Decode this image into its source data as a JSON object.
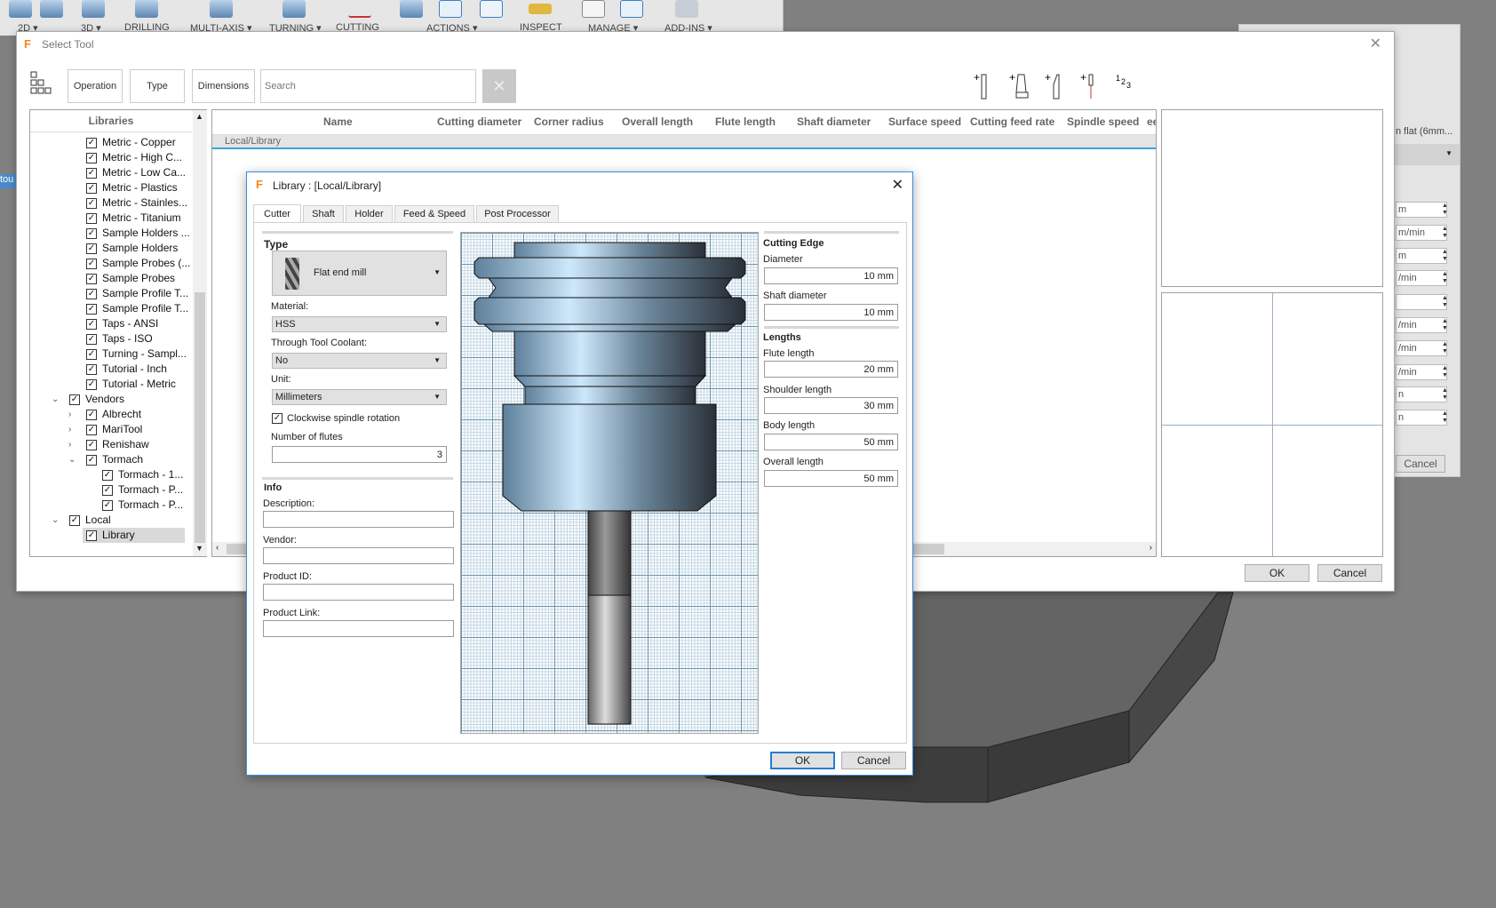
{
  "ribbon": {
    "items": [
      "2D ▾",
      "3D ▾",
      "DRILLING",
      "MULTI-AXIS ▾",
      "TURNING ▾",
      "CUTTING",
      "ACTIONS ▾",
      "INSPECT",
      "MANAGE ▾",
      "ADD-INS ▾"
    ]
  },
  "background_panel": {
    "tool_name": "n flat (6mm...",
    "fields": [
      "m",
      "m/min",
      "m",
      "/min",
      "",
      "/min",
      "/min",
      "/min",
      "n",
      "n"
    ],
    "cancel": "Cancel"
  },
  "left_tab": "tou",
  "select_tool": {
    "title": "Select Tool",
    "filters": {
      "operation": "Operation",
      "type": "Type",
      "dimensions": "Dimensions",
      "search_placeholder": "Search",
      "clear": "✕"
    },
    "libraries_header": "Libraries",
    "tree": [
      {
        "label": "Metric - Copper",
        "level": 2
      },
      {
        "label": "Metric - High C...",
        "level": 2
      },
      {
        "label": "Metric - Low Ca...",
        "level": 2
      },
      {
        "label": "Metric - Plastics",
        "level": 2
      },
      {
        "label": "Metric - Stainles...",
        "level": 2
      },
      {
        "label": "Metric - Titanium",
        "level": 2
      },
      {
        "label": "Sample Holders ...",
        "level": 2
      },
      {
        "label": "Sample Holders",
        "level": 2
      },
      {
        "label": "Sample Probes (...",
        "level": 2
      },
      {
        "label": "Sample Probes",
        "level": 2
      },
      {
        "label": "Sample Profile T...",
        "level": 2
      },
      {
        "label": "Sample Profile T...",
        "level": 2
      },
      {
        "label": "Taps - ANSI",
        "level": 2
      },
      {
        "label": "Taps - ISO",
        "level": 2
      },
      {
        "label": "Turning - Sampl...",
        "level": 2
      },
      {
        "label": "Tutorial - Inch",
        "level": 2
      },
      {
        "label": "Tutorial - Metric",
        "level": 2
      },
      {
        "label": "Vendors",
        "level": 1,
        "chevron": "down"
      },
      {
        "label": "Albrecht",
        "level": 2,
        "chevron": "right"
      },
      {
        "label": "MariTool",
        "level": 2,
        "chevron": "right"
      },
      {
        "label": "Renishaw",
        "level": 2,
        "chevron": "right"
      },
      {
        "label": "Tormach",
        "level": 2,
        "chevron": "down"
      },
      {
        "label": "Tormach - 1...",
        "level": 3
      },
      {
        "label": "Tormach - P...",
        "level": 3
      },
      {
        "label": "Tormach - P...",
        "level": 3
      },
      {
        "label": "Local",
        "level": 1,
        "chevron": "down"
      },
      {
        "label": "Library",
        "level": 2,
        "selected": true
      }
    ],
    "columns": [
      "Name",
      "Cutting diameter",
      "Corner radius",
      "Overall length",
      "Flute length",
      "Shaft diameter",
      "Surface speed",
      "Cutting feed rate",
      "Spindle speed",
      "ee"
    ],
    "group_row": "Local/Library",
    "ok": "OK",
    "cancel": "Cancel"
  },
  "library_dialog": {
    "title": "Library : [Local/Library]",
    "tabs": [
      "Cutter",
      "Shaft",
      "Holder",
      "Feed & Speed",
      "Post Processor"
    ],
    "active_tab": "Cutter",
    "type_heading": "Type",
    "type_value": "Flat end mill",
    "material_label": "Material:",
    "material": "HSS",
    "coolant_label": "Through Tool Coolant:",
    "coolant": "No",
    "unit_label": "Unit:",
    "unit": "Millimeters",
    "clockwise_label": "Clockwise spindle rotation",
    "clockwise": true,
    "flutes_label": "Number of flutes",
    "flutes": "3",
    "info_heading": "Info",
    "description_label": "Description:",
    "vendor_label": "Vendor:",
    "product_id_label": "Product ID:",
    "product_link_label": "Product Link:",
    "cutting_edge_heading": "Cutting Edge",
    "diameter_label": "Diameter",
    "diameter": "10 mm",
    "shaft_diameter_label": "Shaft diameter",
    "shaft_diameter": "10 mm",
    "lengths_heading": "Lengths",
    "flute_length_label": "Flute length",
    "flute_length": "20 mm",
    "shoulder_length_label": "Shoulder length",
    "shoulder_length": "30 mm",
    "body_length_label": "Body length",
    "body_length": "50 mm",
    "overall_length_label": "Overall length",
    "overall_length": "50 mm",
    "ok": "OK",
    "cancel": "Cancel"
  },
  "colors": {
    "accent": "#3b8dd6",
    "background": "#808080",
    "tool_steel": "#7fa3c0"
  }
}
